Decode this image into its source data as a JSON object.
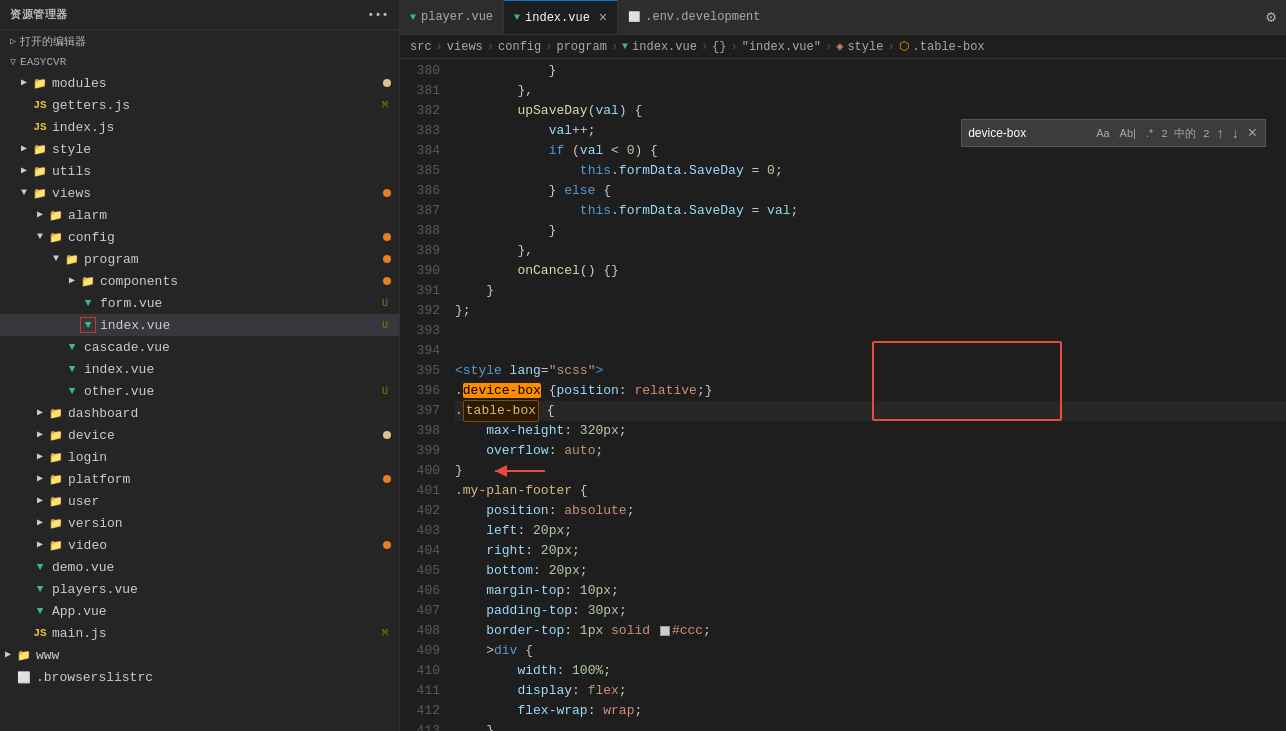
{
  "sidebar": {
    "title": "资源管理器",
    "open_editors_label": "打开的编辑器",
    "root": "EASYCVR",
    "items": [
      {
        "id": "modules",
        "label": "modules",
        "type": "folder",
        "indent": 1,
        "expanded": false,
        "dot": "yellow"
      },
      {
        "id": "getters",
        "label": "getters.js",
        "type": "js",
        "indent": 1,
        "badge": "M"
      },
      {
        "id": "index_js",
        "label": "index.js",
        "type": "js",
        "indent": 1
      },
      {
        "id": "style",
        "label": "style",
        "type": "folder",
        "indent": 1,
        "expanded": false
      },
      {
        "id": "utils",
        "label": "utils",
        "type": "folder",
        "indent": 1,
        "expanded": false
      },
      {
        "id": "views",
        "label": "views",
        "type": "folder",
        "indent": 1,
        "expanded": true,
        "dot": "orange"
      },
      {
        "id": "alarm",
        "label": "alarm",
        "type": "folder",
        "indent": 2,
        "expanded": false
      },
      {
        "id": "config",
        "label": "config",
        "type": "folder",
        "indent": 2,
        "expanded": true,
        "dot": "orange"
      },
      {
        "id": "program",
        "label": "program",
        "type": "folder",
        "indent": 3,
        "expanded": true,
        "dot": "orange"
      },
      {
        "id": "components",
        "label": "components",
        "type": "folder",
        "indent": 4,
        "expanded": false,
        "dot": "orange"
      },
      {
        "id": "form_vue",
        "label": "form.vue",
        "type": "vue",
        "indent": 4,
        "badge": "U"
      },
      {
        "id": "index_vue",
        "label": "index.vue",
        "type": "vue",
        "indent": 4,
        "badge": "U",
        "selected": true
      },
      {
        "id": "cascade_vue",
        "label": "cascade.vue",
        "type": "vue",
        "indent": 3
      },
      {
        "id": "index_vue2",
        "label": "index.vue",
        "type": "vue",
        "indent": 3
      },
      {
        "id": "other_vue",
        "label": "other.vue",
        "type": "vue",
        "indent": 3,
        "badge": "U"
      },
      {
        "id": "dashboard",
        "label": "dashboard",
        "type": "folder",
        "indent": 2,
        "expanded": false
      },
      {
        "id": "device",
        "label": "device",
        "type": "folder",
        "indent": 2,
        "expanded": false,
        "dot": "yellow"
      },
      {
        "id": "login",
        "label": "login",
        "type": "folder",
        "indent": 2,
        "expanded": false
      },
      {
        "id": "platform",
        "label": "platform",
        "type": "folder",
        "indent": 2,
        "expanded": false,
        "dot": "orange"
      },
      {
        "id": "user",
        "label": "user",
        "type": "folder",
        "indent": 2,
        "expanded": false
      },
      {
        "id": "version",
        "label": "version",
        "type": "folder",
        "indent": 2,
        "expanded": false
      },
      {
        "id": "video",
        "label": "video",
        "type": "folder",
        "indent": 2,
        "expanded": false,
        "dot": "orange"
      },
      {
        "id": "demo_vue",
        "label": "demo.vue",
        "type": "vue",
        "indent": 1
      },
      {
        "id": "players_vue",
        "label": "players.vue",
        "type": "vue",
        "indent": 1
      },
      {
        "id": "app_vue",
        "label": "App.vue",
        "type": "vue",
        "indent": 1
      },
      {
        "id": "main_js",
        "label": "main.js",
        "type": "js",
        "indent": 1,
        "badge": "M"
      },
      {
        "id": "www",
        "label": "www",
        "type": "folder",
        "indent": 0,
        "expanded": false
      },
      {
        "id": "browserslistrc",
        "label": ".browserslistrc",
        "type": "file",
        "indent": 0
      }
    ]
  },
  "tabs": [
    {
      "id": "player_vue",
      "label": "player.vue",
      "type": "vue",
      "active": false
    },
    {
      "id": "index_vue",
      "label": "index.vue",
      "type": "vue",
      "active": true,
      "modified": true
    },
    {
      "id": "env_dev",
      "label": ".env.development",
      "type": "file",
      "active": false
    }
  ],
  "breadcrumb": {
    "parts": [
      "src",
      "views",
      "config",
      "program",
      "index.vue",
      "{}",
      "\"index.vue\"",
      "style",
      ".table-box"
    ]
  },
  "search": {
    "value": "device-box",
    "count": "2 中的 2"
  },
  "lines": [
    {
      "num": 380,
      "content": "            }"
    },
    {
      "num": 381,
      "content": "        },"
    },
    {
      "num": 382,
      "content": "        upSaveDay(val) {"
    },
    {
      "num": 383,
      "content": "            val++;"
    },
    {
      "num": 384,
      "content": "            if (val < 0) {"
    },
    {
      "num": 385,
      "content": "                this.formData.SaveDay = 0;"
    },
    {
      "num": 386,
      "content": "            } else {"
    },
    {
      "num": 387,
      "content": "                this.formData.SaveDay = val;"
    },
    {
      "num": 388,
      "content": "            }"
    },
    {
      "num": 389,
      "content": "        },"
    },
    {
      "num": 390,
      "content": "        onCancel() {}"
    },
    {
      "num": 391,
      "content": "    }"
    },
    {
      "num": 392,
      "content": "};"
    },
    {
      "num": 393,
      "content": ""
    },
    {
      "num": 394,
      "content": ""
    },
    {
      "num": 395,
      "content": "<style lang=\"scss\">"
    },
    {
      "num": 396,
      "content": ".device-box {position: relative;}"
    },
    {
      "num": 397,
      "content": ".table-box {"
    },
    {
      "num": 398,
      "content": "    max-height: 320px;"
    },
    {
      "num": 399,
      "content": "    overflow: auto;"
    },
    {
      "num": 400,
      "content": "}"
    },
    {
      "num": 401,
      "content": ".my-plan-footer {"
    },
    {
      "num": 402,
      "content": "    position: absolute;"
    },
    {
      "num": 403,
      "content": "    left: 20px;"
    },
    {
      "num": 404,
      "content": "    right: 20px;"
    },
    {
      "num": 405,
      "content": "    bottom: 20px;"
    },
    {
      "num": 406,
      "content": "    margin-top: 10px;"
    },
    {
      "num": 407,
      "content": "    padding-top: 30px;"
    },
    {
      "num": 408,
      "content": "    border-top: 1px solid  #ccc;"
    },
    {
      "num": 409,
      "content": "    >div {"
    },
    {
      "num": 410,
      "content": "        width: 100%;"
    },
    {
      "num": 411,
      "content": "        display: flex;"
    },
    {
      "num": 412,
      "content": "        flex-wrap: wrap;"
    },
    {
      "num": 413,
      "content": "    }"
    }
  ]
}
